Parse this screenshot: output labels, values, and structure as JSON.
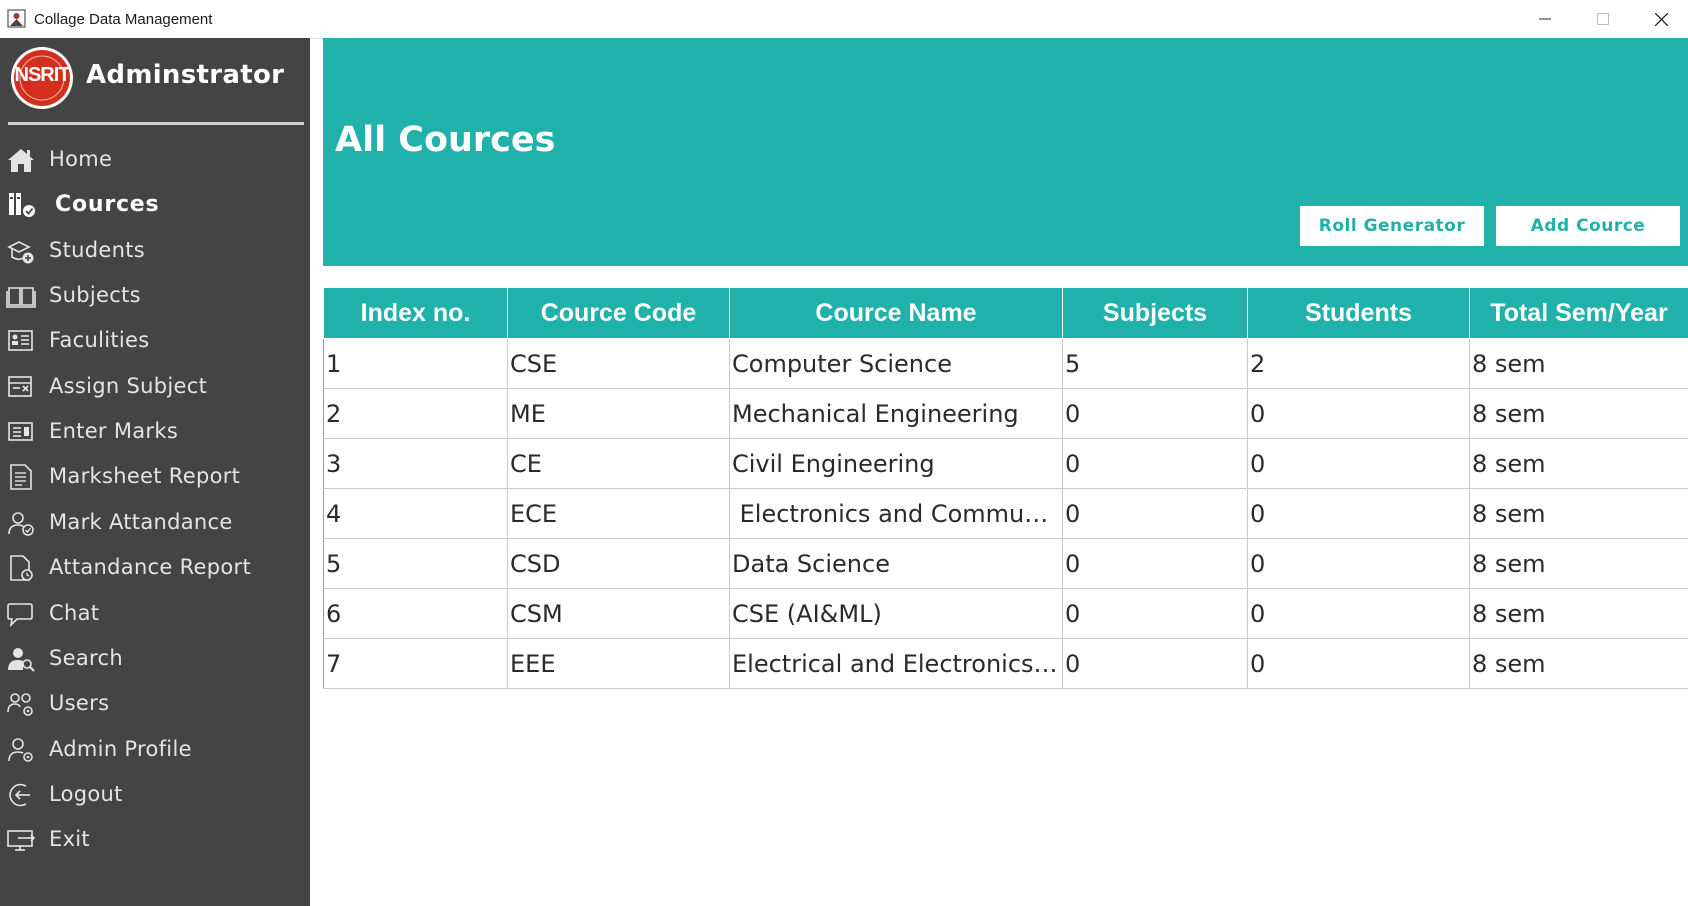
{
  "window": {
    "title": "Collage Data Management",
    "controls": [
      "minimize",
      "maximize",
      "close"
    ]
  },
  "sidebar": {
    "logo_text": "NSRIT",
    "title": "Adminstrator",
    "items": [
      {
        "label": "Home",
        "icon": "home-icon",
        "active": false
      },
      {
        "label": "Cources",
        "icon": "courses-icon",
        "active": true
      },
      {
        "label": "Students",
        "icon": "students-icon",
        "active": false
      },
      {
        "label": "Subjects",
        "icon": "book-icon",
        "active": false
      },
      {
        "label": "Faculities",
        "icon": "faculty-icon",
        "active": false
      },
      {
        "label": "Assign Subject",
        "icon": "assign-icon",
        "active": false
      },
      {
        "label": "Enter Marks",
        "icon": "marks-icon",
        "active": false
      },
      {
        "label": "Marksheet Report",
        "icon": "report-icon",
        "active": false
      },
      {
        "label": "Mark Attandance",
        "icon": "attendance-icon",
        "active": false
      },
      {
        "label": "Attandance Report",
        "icon": "attendance-report-icon",
        "active": false
      },
      {
        "label": "Chat",
        "icon": "chat-icon",
        "active": false
      },
      {
        "label": "Search",
        "icon": "search-user-icon",
        "active": false
      },
      {
        "label": "Users",
        "icon": "users-icon",
        "active": false
      },
      {
        "label": "Admin Profile",
        "icon": "admin-profile-icon",
        "active": false
      },
      {
        "label": "Logout",
        "icon": "logout-icon",
        "active": false
      },
      {
        "label": "Exit",
        "icon": "exit-icon",
        "active": false
      }
    ]
  },
  "header": {
    "title": "All Cources",
    "roll_generator_label": "Roll Generator",
    "add_cource_label": "Add Cource"
  },
  "table": {
    "columns": [
      "Index no.",
      "Cource Code",
      "Cource Name",
      "Subjects",
      "Students",
      "Total Sem/Year"
    ],
    "rows": [
      [
        "1",
        "CSE",
        "Computer Science",
        "5",
        "2",
        "8 sem"
      ],
      [
        "2",
        "ME",
        "Mechanical Engineering",
        "0",
        "0",
        "8 sem"
      ],
      [
        "3",
        "CE",
        "Civil Engineering",
        "0",
        "0",
        "8 sem"
      ],
      [
        "4",
        "ECE",
        " Electronics and Communication Engineering",
        "0",
        "0",
        "8 sem"
      ],
      [
        "5",
        "CSD",
        "Data Science",
        "0",
        "0",
        "8 sem"
      ],
      [
        "6",
        "CSM",
        "CSE (AI&ML)",
        "0",
        "0",
        "8 sem"
      ],
      [
        "7",
        "EEE",
        "Electrical and Electronics Eng",
        "0",
        "0",
        "8 sem"
      ]
    ]
  },
  "colors": {
    "accent": "#20b2aa",
    "sidebar_bg": "#444444",
    "logo_red": "#d32f1e",
    "text_light": "#ffffff"
  }
}
